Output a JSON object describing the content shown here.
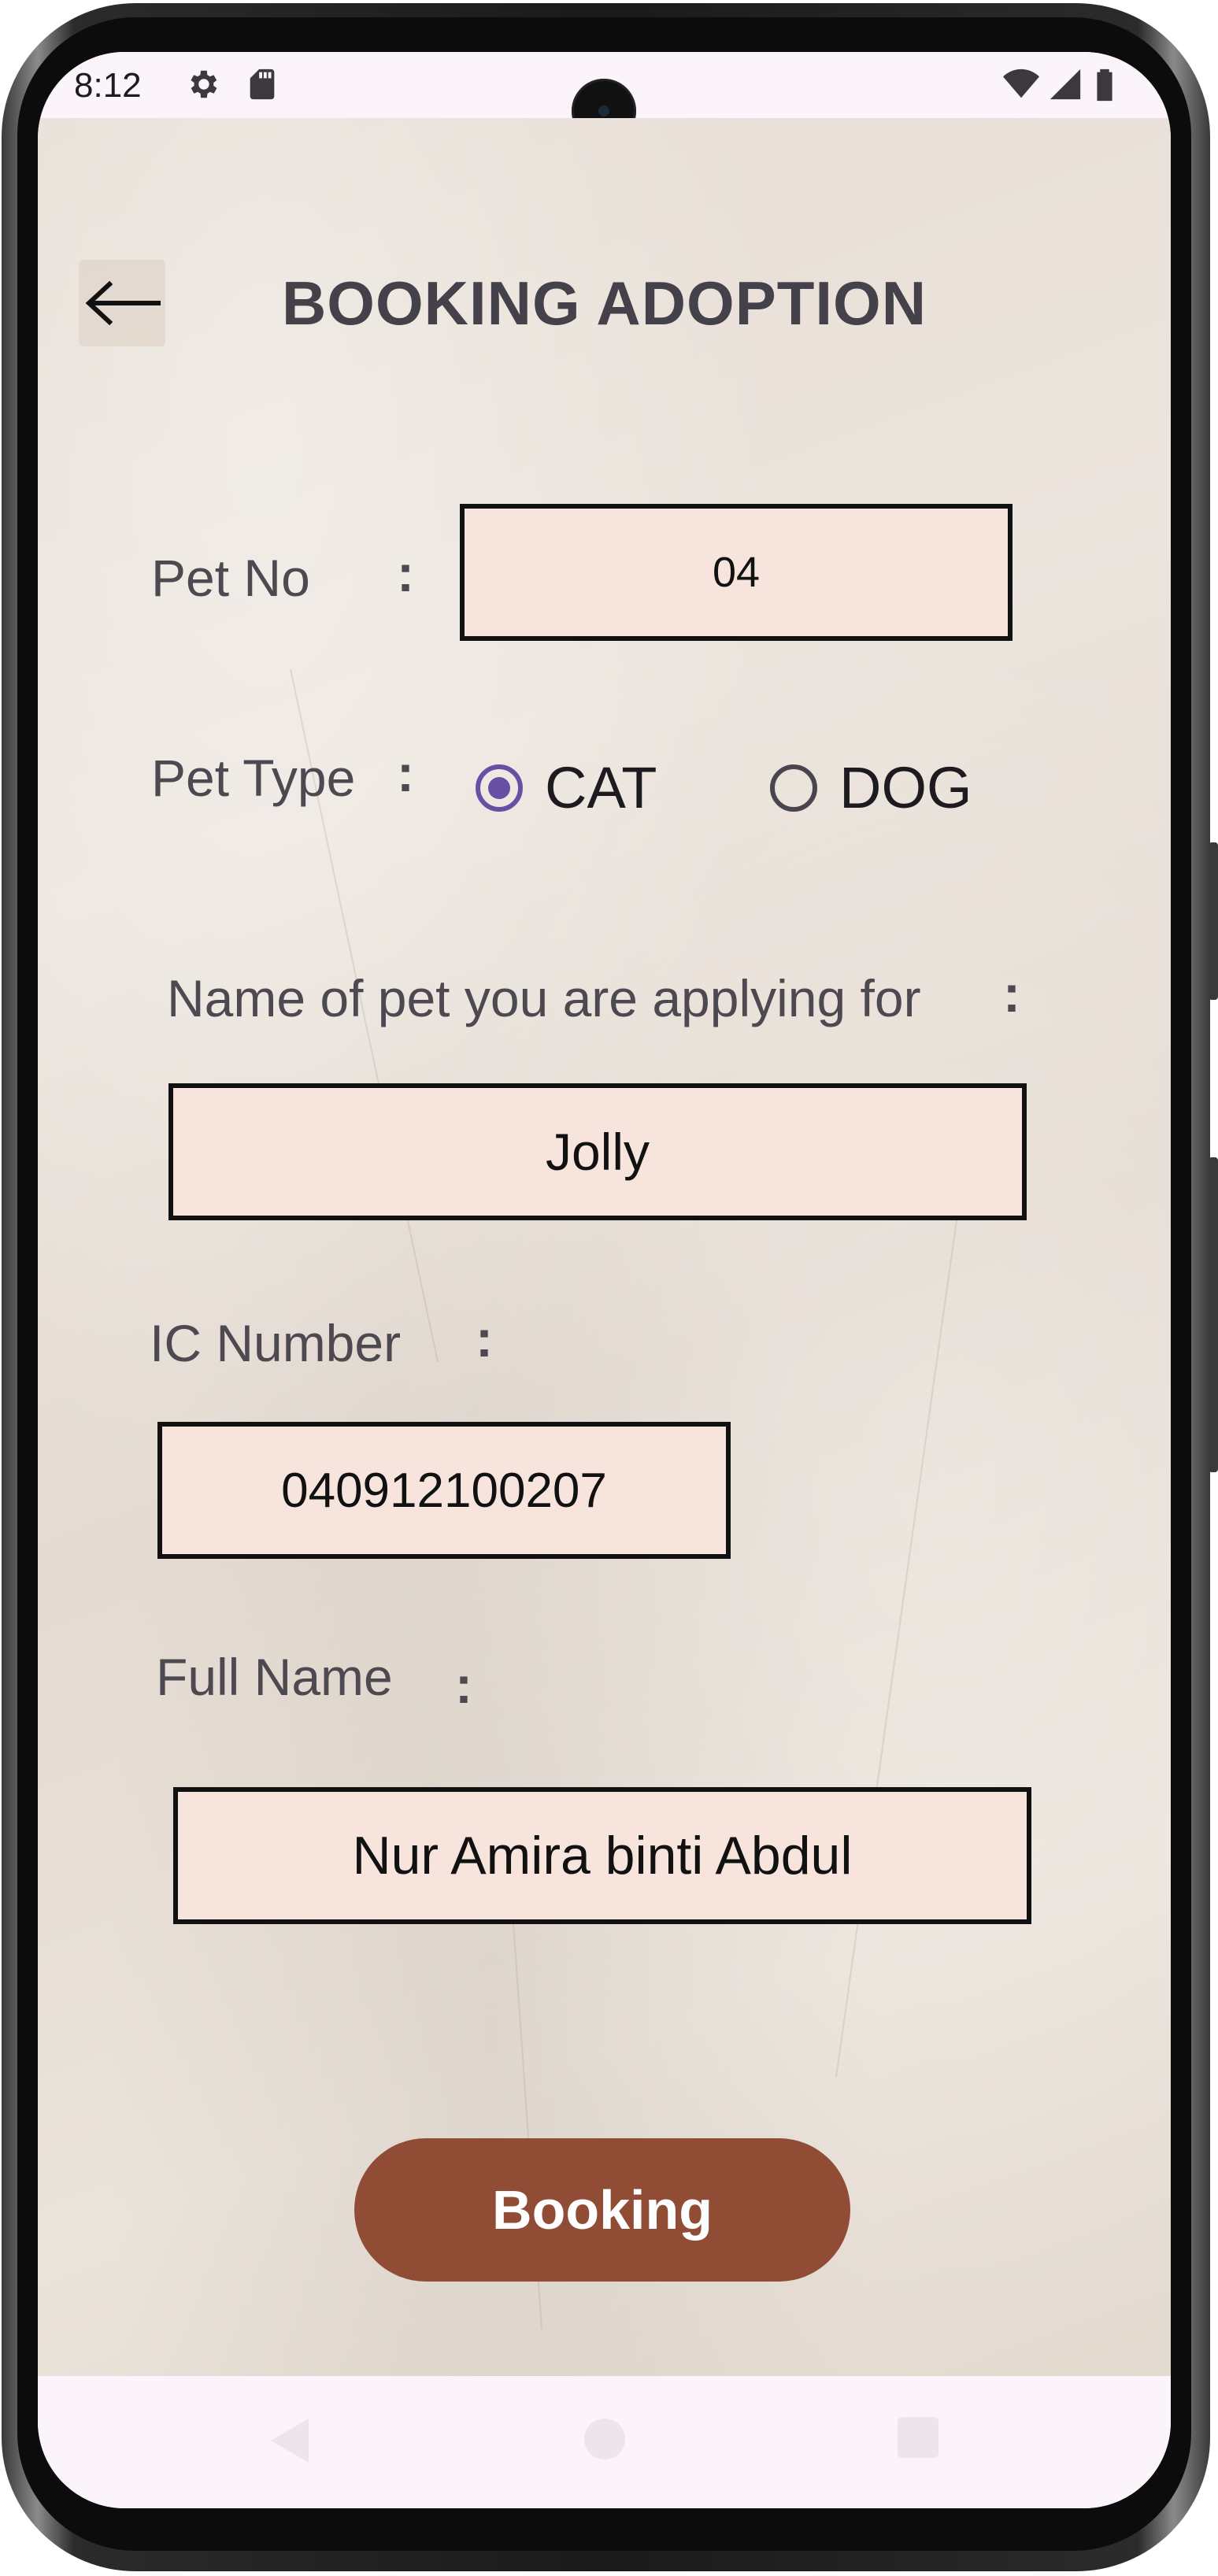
{
  "status_bar": {
    "time": "8:12",
    "icons": [
      "gear-icon",
      "sd-card-icon",
      "wifi-icon",
      "cell-signal-icon",
      "battery-icon"
    ]
  },
  "header": {
    "back_icon": "arrow-left-icon",
    "title": "BOOKING ADOPTION"
  },
  "form": {
    "pet_no": {
      "label": "Pet No",
      "colon": ":",
      "value": "04"
    },
    "pet_type": {
      "label": "Pet Type",
      "colon": ":",
      "options": [
        {
          "label": "CAT",
          "selected": true
        },
        {
          "label": "DOG",
          "selected": false
        }
      ]
    },
    "pet_name": {
      "label": "Name of pet you are applying for",
      "colon": ":",
      "value": "Jolly"
    },
    "ic_number": {
      "label": "IC Number",
      "colon": ":",
      "value": "040912100207"
    },
    "full_name": {
      "label": "Full Name",
      "colon": ":",
      "value": "Nur Amira binti Abdul"
    }
  },
  "actions": {
    "booking_label": "Booking"
  },
  "nav_bar": {
    "icons": [
      "nav-back-icon",
      "nav-home-icon",
      "nav-recents-icon"
    ]
  },
  "colors": {
    "accent_radio": "#6750a4",
    "button": "#914c36",
    "field_fill": "#f6e4dd"
  }
}
